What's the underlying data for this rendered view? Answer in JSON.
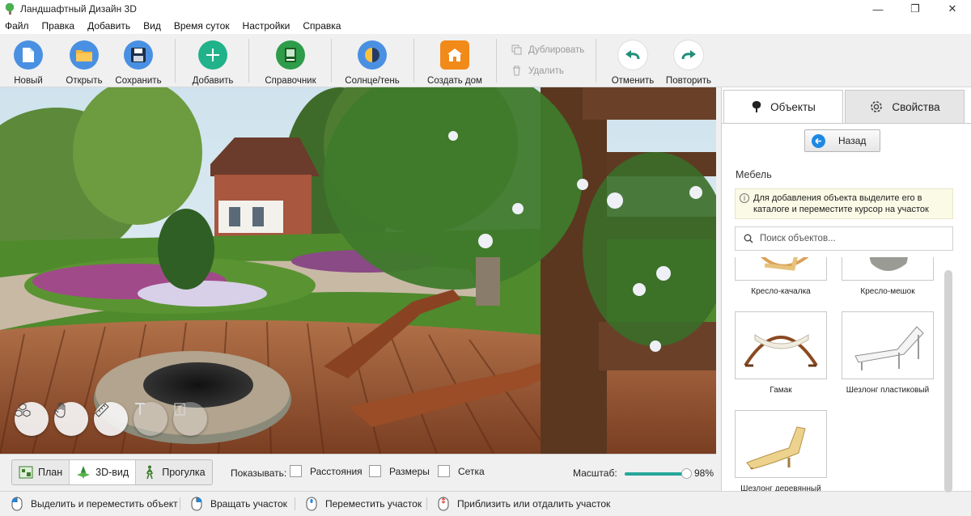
{
  "window": {
    "title": "Ландшафтный Дизайн 3D",
    "minimize": "—",
    "maximize": "❐",
    "close": "✕"
  },
  "menu": [
    "Файл",
    "Правка",
    "Добавить",
    "Вид",
    "Время суток",
    "Настройки",
    "Справка"
  ],
  "toolbar": {
    "new": "Новый",
    "open": "Открыть",
    "save": "Сохранить",
    "add": "Добавить",
    "reference": "Справочник",
    "sun_shadow": "Солнце/тень",
    "create_house": "Создать дом",
    "duplicate": "Дублировать",
    "delete": "Удалить",
    "undo": "Отменить",
    "redo": "Повторить"
  },
  "view_tabs": [
    {
      "label": "План",
      "icon": "plan-icon",
      "active": false
    },
    {
      "label": "3D-вид",
      "icon": "3d-view-icon",
      "active": true
    },
    {
      "label": "Прогулка",
      "icon": "walk-icon",
      "active": false
    }
  ],
  "show": {
    "label": "Показывать:",
    "options": [
      {
        "label": "Расстояния",
        "checked": false
      },
      {
        "label": "Размеры",
        "checked": false
      },
      {
        "label": "Сетка",
        "checked": false
      }
    ]
  },
  "scale": {
    "label": "Масштаб:",
    "value": 98,
    "value_text": "98%"
  },
  "status": {
    "select_move": "Выделить и переместить объект",
    "rotate": "Вращать участок",
    "move": "Переместить участок",
    "zoom": "Приблизить или отдалить участок"
  },
  "panel": {
    "tab_objects": "Объекты",
    "tab_properties": "Свойства",
    "back": "Назад",
    "category": "Мебель",
    "hint": "Для добавления объекта выделите его в каталоге и переместите курсор на участок",
    "search_placeholder": "Поиск объектов...",
    "items": [
      {
        "label": "Кресло-качалка",
        "icon": "rocking-chair-icon"
      },
      {
        "label": "Кресло-мешок",
        "icon": "bean-bag-icon"
      },
      {
        "label": "Гамак",
        "icon": "hammock-icon"
      },
      {
        "label": "Шезлонг пластиковый",
        "icon": "plastic-lounger-icon"
      },
      {
        "label": "Шезлонг деревянный",
        "icon": "wooden-lounger-icon"
      }
    ]
  },
  "colors": {
    "accent": "#26a69a",
    "selection": "#1e88e5"
  }
}
